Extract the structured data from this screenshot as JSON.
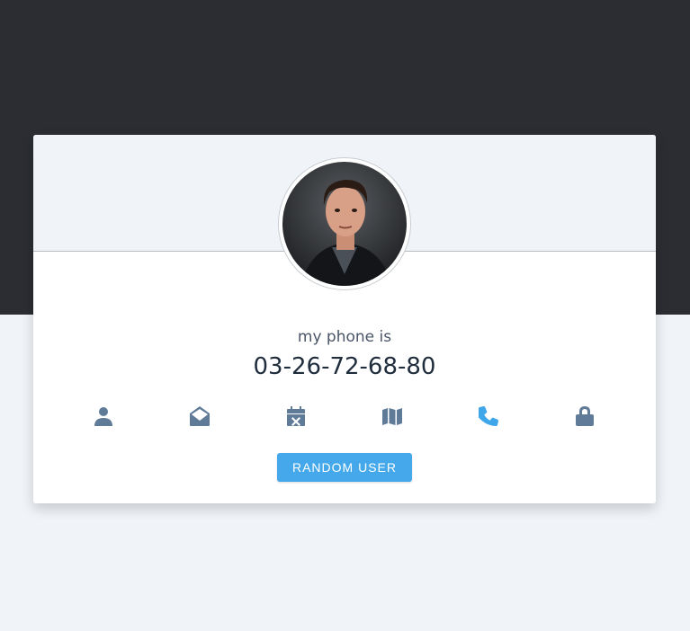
{
  "card": {
    "label": "my phone is",
    "value": "03-26-72-68-80"
  },
  "icons": [
    {
      "name": "user-icon",
      "active": false
    },
    {
      "name": "envelope-open-icon",
      "active": false
    },
    {
      "name": "calendar-times-icon",
      "active": false
    },
    {
      "name": "map-icon",
      "active": false
    },
    {
      "name": "phone-icon",
      "active": true
    },
    {
      "name": "lock-icon",
      "active": false
    }
  ],
  "button": {
    "label": "RANDOM USER"
  },
  "colors": {
    "top_band": "#2b2d32",
    "background": "#f0f4f8",
    "icon": "#607b98",
    "icon_active": "#40a6ea",
    "button": "#44a8ea"
  }
}
